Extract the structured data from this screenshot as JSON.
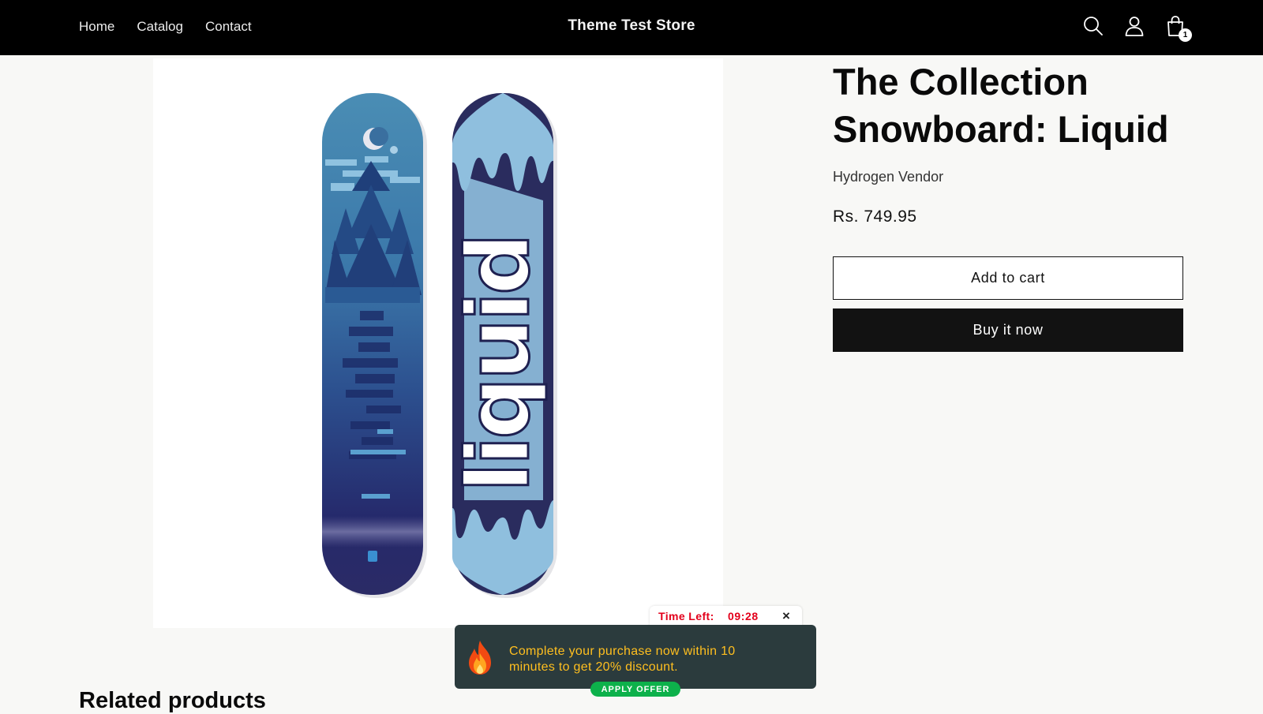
{
  "header": {
    "nav": [
      "Home",
      "Catalog",
      "Contact"
    ],
    "store_name": "Theme Test Store",
    "cart_count": "1",
    "icons": [
      "search-icon",
      "account-icon",
      "cart-icon"
    ]
  },
  "product": {
    "title": "The Collection Snowboard: Liquid",
    "vendor": "Hydrogen Vendor",
    "price": "Rs. 749.95",
    "add_to_cart_label": "Add to cart",
    "buy_now_label": "Buy it now",
    "board_graphic_text": "liquid"
  },
  "related": {
    "heading": "Related products"
  },
  "offer_popup": {
    "timer_label": "Time Left:",
    "timer_value": "09:28",
    "close_label": "×",
    "message": "Complete your purchase now within 10 minutes to get 20% discount.",
    "apply_label": "APPLY OFFER",
    "icon": "fire-icon"
  },
  "colors": {
    "header_bg": "#000000",
    "page_bg": "#f8f8f6",
    "buy_button_bg": "#121212",
    "timer_red": "#e3001b",
    "offer_bg": "#2b3b3d",
    "offer_text": "#ffbf1f",
    "apply_green": "#0db14b"
  }
}
